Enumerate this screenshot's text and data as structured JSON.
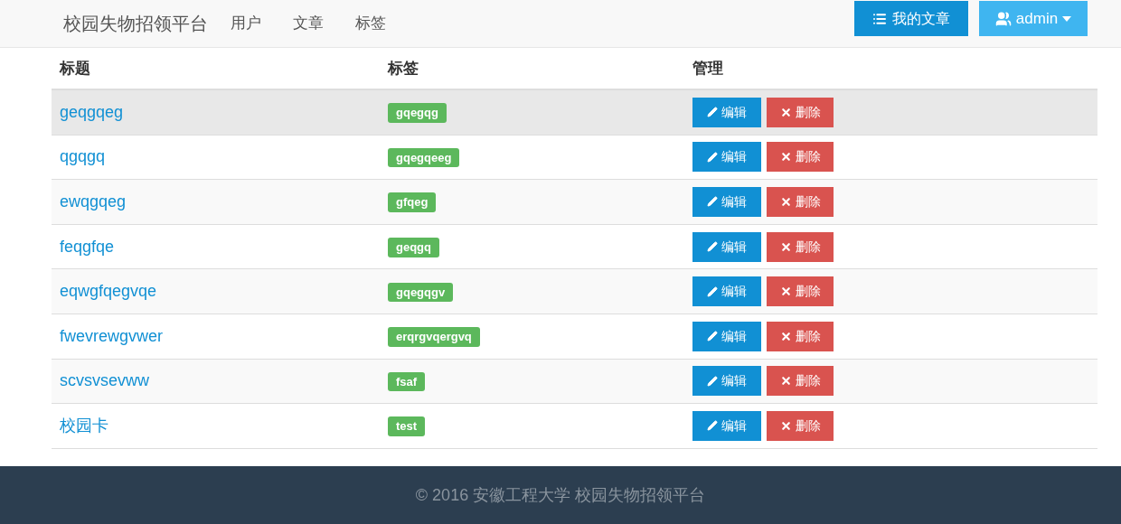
{
  "navbar": {
    "brand": "校园失物招领平台",
    "links": [
      "用户",
      "文章",
      "标签"
    ],
    "my_articles_button": "我的文章",
    "user_menu": "admin"
  },
  "table": {
    "columns": [
      "标题",
      "标签",
      "管理"
    ],
    "rows": [
      {
        "title": "geqgqeg",
        "tag": "gqegqg",
        "edit": "编辑",
        "delete": "删除",
        "highlighted": true
      },
      {
        "title": "qgqgq",
        "tag": "gqegqeeg",
        "edit": "编辑",
        "delete": "删除",
        "highlighted": false
      },
      {
        "title": "ewqgqeg",
        "tag": "gfqeg",
        "edit": "编辑",
        "delete": "删除",
        "highlighted": false
      },
      {
        "title": "feqgfqe",
        "tag": "geqgq",
        "edit": "编辑",
        "delete": "删除",
        "highlighted": false
      },
      {
        "title": "eqwgfqegvqe",
        "tag": "gqegqgv",
        "edit": "编辑",
        "delete": "删除",
        "highlighted": false
      },
      {
        "title": "fwevrewgvwer",
        "tag": "erqrgvqergvq",
        "edit": "编辑",
        "delete": "删除",
        "highlighted": false
      },
      {
        "title": "scvsvsevww",
        "tag": "fsaf",
        "edit": "编辑",
        "delete": "删除",
        "highlighted": false
      },
      {
        "title": "校园卡",
        "tag": "test",
        "edit": "编辑",
        "delete": "删除",
        "highlighted": false
      }
    ]
  },
  "footer": {
    "text": "© 2016 安徽工程大学 校园失物招领平台"
  }
}
